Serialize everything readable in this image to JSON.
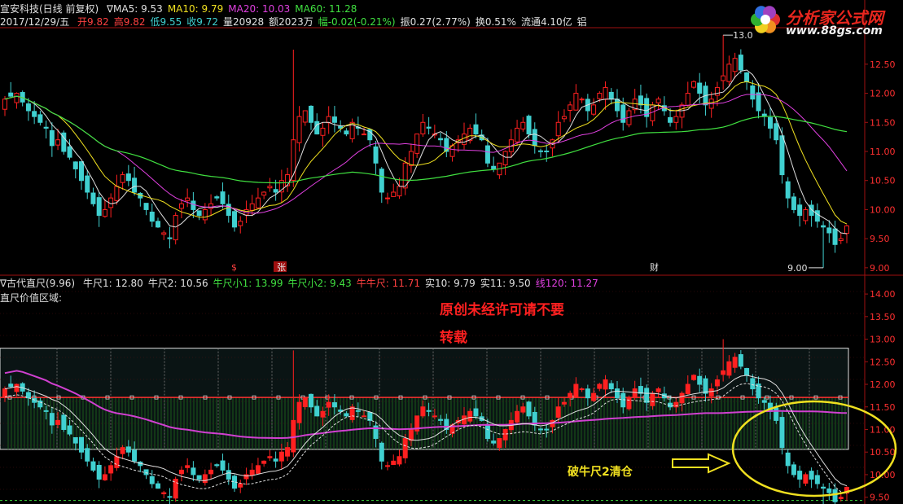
{
  "header": {
    "stock": "宣安科技(日线 前复权)",
    "ma_labels": [
      {
        "text": "∇MA5: 9.53",
        "color": "#e0e0e0"
      },
      {
        "text": "MA10: 9.79",
        "color": "#f0e020"
      },
      {
        "text": "MA20: 10.03",
        "color": "#e040e0"
      },
      {
        "text": "MA60: 11.28",
        "color": "#40e040"
      }
    ],
    "date": "2017/12/29/五",
    "quote": [
      {
        "text": "开9.82",
        "color": "#ff4040"
      },
      {
        "text": "高9.82",
        "color": "#ff4040"
      },
      {
        "text": "低9.55",
        "color": "#40d0d0"
      },
      {
        "text": "收9.72",
        "color": "#40d0d0"
      },
      {
        "text": "量20928",
        "color": "#e0e0e0"
      },
      {
        "text": "额2023万",
        "color": "#e0e0e0"
      },
      {
        "text": "幅-0.02(-0.21%)",
        "color": "#40e040"
      },
      {
        "text": "振0.27(2.77%)",
        "color": "#e0e0e0"
      },
      {
        "text": "换0.51%",
        "color": "#e0e0e0"
      },
      {
        "text": "流通4.10亿",
        "color": "#e0e0e0"
      },
      {
        "text": "铝",
        "color": "#e0e0e0"
      }
    ]
  },
  "logo": {
    "brand": "分析家公式网",
    "url": "www.88gs.com"
  },
  "indicator": {
    "title": "∇古代直尺(9.96)",
    "labels": [
      {
        "text": "牛尺1: 12.80",
        "color": "#e0e0e0"
      },
      {
        "text": "牛尺2: 10.56",
        "color": "#e0e0e0"
      },
      {
        "text": "牛尺小1: 13.99",
        "color": "#40e040"
      },
      {
        "text": "牛尺小2: 9.43",
        "color": "#40e040"
      },
      {
        "text": "牛牛尺: 11.71",
        "color": "#ff4040"
      },
      {
        "text": "实10: 9.79",
        "color": "#e0e0e0"
      },
      {
        "text": "实11: 9.50",
        "color": "#e0e0e0"
      },
      {
        "text": "线120: 11.27",
        "color": "#e040e0"
      }
    ],
    "subtitle": "直尺价值区域:"
  },
  "annotations": {
    "notice_line1": "原创未经许可请不要",
    "notice_line2": "转载",
    "signal": "破牛尺2清仓",
    "markers": [
      "$",
      "张",
      "财"
    ],
    "high_label": "13.0",
    "low_label": "9.00"
  },
  "chart_data": [
    {
      "type": "candlestick",
      "panel": "price",
      "yaxis_ticks": [
        "12.50",
        "12.00",
        "11.50",
        "11.00",
        "10.50",
        "10.00",
        "9.50",
        "9.00"
      ],
      "ylim": [
        8.9,
        13.1
      ],
      "series": [
        {
          "name": "MA5",
          "color": "#e0e0e0",
          "value": 9.53
        },
        {
          "name": "MA10",
          "color": "#f0e020",
          "value": 9.79
        },
        {
          "name": "MA20",
          "color": "#e040e0",
          "value": 10.03
        },
        {
          "name": "MA60",
          "color": "#40e040",
          "value": 11.28
        }
      ],
      "closes": [
        11.9,
        11.95,
        12.0,
        11.85,
        11.7,
        11.6,
        11.5,
        11.4,
        11.1,
        11.2,
        11.0,
        10.9,
        10.7,
        10.5,
        10.3,
        10.1,
        9.9,
        10.0,
        10.2,
        10.4,
        10.6,
        10.5,
        10.3,
        10.2,
        10.0,
        9.8,
        9.7,
        9.6,
        9.5,
        9.9,
        10.1,
        10.2,
        10.0,
        9.9,
        10.0,
        10.1,
        10.2,
        10.1,
        9.9,
        9.7,
        9.8,
        10.0,
        10.1,
        10.2,
        10.3,
        10.4,
        10.3,
        10.5,
        10.6,
        11.2,
        11.6,
        11.7,
        11.5,
        11.3,
        11.4,
        11.6,
        11.5,
        11.4,
        11.3,
        11.5,
        11.4,
        11.3,
        11.2,
        10.8,
        10.3,
        10.2,
        10.3,
        10.4,
        10.8,
        11.0,
        11.3,
        11.5,
        11.4,
        11.3,
        11.2,
        11.0,
        11.1,
        11.2,
        11.3,
        11.4,
        11.3,
        11.2,
        10.8,
        10.7,
        10.8,
        11.0,
        11.2,
        11.4,
        11.5,
        11.3,
        11.1,
        11.0,
        11.0,
        11.2,
        11.5,
        11.6,
        11.8,
        12.0,
        11.9,
        11.7,
        11.8,
        12.0,
        12.1,
        11.9,
        11.7,
        11.5,
        11.7,
        11.9,
        11.8,
        11.6,
        11.8,
        11.9,
        11.7,
        11.5,
        11.6,
        11.8,
        12.0,
        12.2,
        12.0,
        11.8,
        11.9,
        12.1,
        12.3,
        12.5,
        12.6,
        12.4,
        12.2,
        11.9,
        11.7,
        11.6,
        11.4,
        11.2,
        10.6,
        10.2,
        10.0,
        9.9,
        10.0,
        9.9,
        9.8,
        9.7,
        9.6,
        9.4,
        9.5,
        9.72
      ]
    },
    {
      "type": "indicator",
      "panel": "ruler",
      "yaxis_ticks": [
        "14.00",
        "13.50",
        "13.00",
        "12.50",
        "12.00",
        "11.50",
        "11.00",
        "10.50",
        "10.00",
        "9.50"
      ],
      "ylim": [
        9.35,
        14.2
      ],
      "lines": [
        {
          "name": "牛尺1",
          "value": 12.8,
          "color": "#e0e0e0"
        },
        {
          "name": "牛尺2",
          "value": 10.56,
          "color": "#e0e0e0"
        },
        {
          "name": "牛牛尺",
          "value": 11.71,
          "color": "#ff4040"
        },
        {
          "name": "线120",
          "value": 11.27,
          "color": "#e040e0"
        }
      ]
    }
  ]
}
